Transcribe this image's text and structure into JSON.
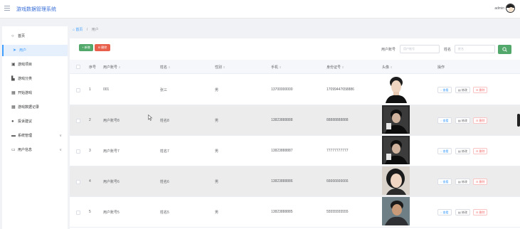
{
  "header": {
    "title": "游戏数据管理系统",
    "username": "admin"
  },
  "sidebar": {
    "items": [
      {
        "label": "首页",
        "icon": "home-icon"
      },
      {
        "label": "用户",
        "icon": "send-icon",
        "active": true
      },
      {
        "label": "游戏项目",
        "icon": "box-icon"
      },
      {
        "label": "游戏分类",
        "icon": "chart-icon"
      },
      {
        "label": "开始游戏",
        "icon": "grid-icon"
      },
      {
        "label": "游戏数据记录",
        "icon": "grid-icon"
      },
      {
        "label": "投诉建议",
        "icon": "bulb-icon"
      },
      {
        "label": "系统管理",
        "icon": "toolbox-icon",
        "expandable": true
      },
      {
        "label": "用户信息",
        "icon": "id-card-icon",
        "expandable": true
      }
    ]
  },
  "breadcrumb": {
    "home": "首页",
    "separator": "/",
    "current": "用户"
  },
  "toolbar": {
    "add_label": "+ 新增",
    "delete_label": "删除"
  },
  "filters": {
    "account": {
      "label": "用户账号",
      "placeholder": "用户账号"
    },
    "name": {
      "label": "姓名",
      "placeholder": "姓名"
    }
  },
  "table": {
    "columns": [
      "序号",
      "用户账号",
      "姓名",
      "性别",
      "手机",
      "身份证号",
      "头像",
      "操作"
    ],
    "sort_mark": "⇕",
    "rows": [
      {
        "index": "1",
        "account": "001",
        "name": "张三",
        "gender": "男",
        "phone": "13700000000",
        "idcard": "17099447658886"
      },
      {
        "index": "2",
        "account": "用户账号8",
        "name": "姓名8",
        "gender": "男",
        "phone": "13823888888",
        "idcard": "88888888888"
      },
      {
        "index": "3",
        "account": "用户账号7",
        "name": "姓名7",
        "gender": "男",
        "phone": "13823888887",
        "idcard": "77777777777"
      },
      {
        "index": "4",
        "account": "用户账号6",
        "name": "姓名6",
        "gender": "男",
        "phone": "13823888886",
        "idcard": "66666666666"
      },
      {
        "index": "5",
        "account": "用户账号5",
        "name": "姓名5",
        "gender": "男",
        "phone": "13823888885",
        "idcard": "55555555555"
      }
    ],
    "actions": {
      "view": "查看",
      "edit": "修改",
      "delete": "删除"
    }
  },
  "colors": {
    "primary": "#409eff",
    "success": "#52a86b",
    "danger": "#e8604c",
    "title": "#3a6fd8"
  }
}
